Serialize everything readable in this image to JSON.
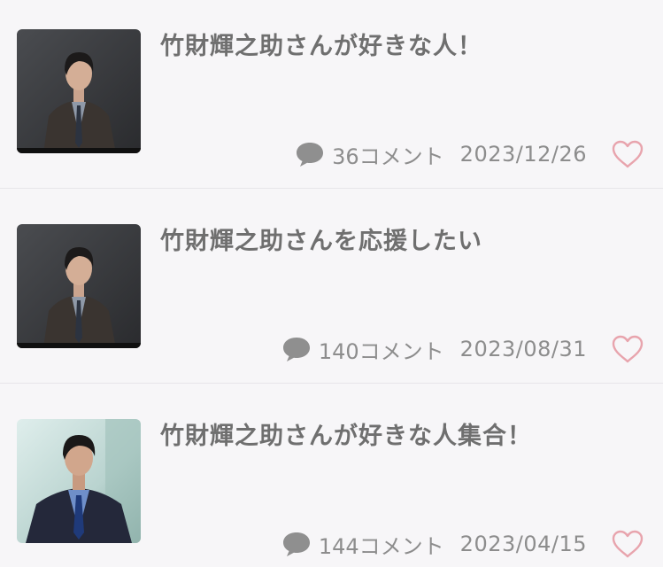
{
  "topics": [
    {
      "title": "竹財輝之助さんが好きな人！",
      "comments": "36コメント",
      "date": "2023/12/26",
      "thumb_bg": "dark-gray"
    },
    {
      "title": "竹財輝之助さんを応援したい",
      "comments": "140コメント",
      "date": "2023/08/31",
      "thumb_bg": "dark-gray"
    },
    {
      "title": "竹財輝之助さんが好きな人集合！",
      "comments": "144コメント",
      "date": "2023/04/15",
      "thumb_bg": "light-teal"
    }
  ],
  "icons": {
    "comment": "speech-bubble-icon",
    "favorite": "heart-outline-icon"
  },
  "colors": {
    "background": "#f7f6f8",
    "title_text": "#6f6f6f",
    "meta_text": "#8d8d8d",
    "heart": "#e8a4ad"
  }
}
